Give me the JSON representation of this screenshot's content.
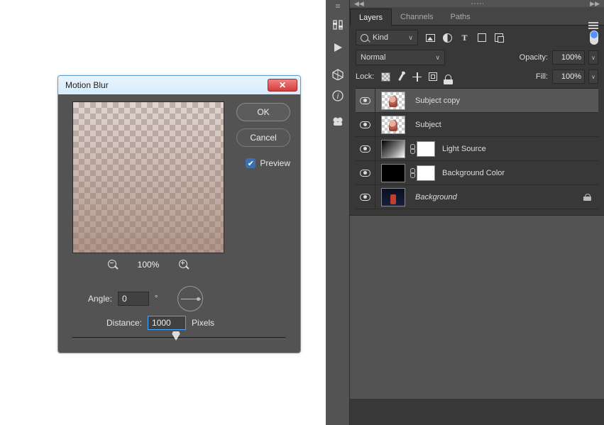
{
  "dialog": {
    "title": "Motion Blur",
    "ok": "OK",
    "cancel": "Cancel",
    "preview_label": "Preview",
    "preview_checked": true,
    "zoom": "100%",
    "angle_label": "Angle:",
    "angle_value": "0",
    "angle_unit": "°",
    "distance_label": "Distance:",
    "distance_value": "1000",
    "distance_unit": "Pixels"
  },
  "panel": {
    "tabs": [
      "Layers",
      "Channels",
      "Paths"
    ],
    "active_tab": 0,
    "filter": {
      "kind_label": "Kind"
    },
    "blend": {
      "mode": "Normal",
      "opacity_label": "Opacity:",
      "opacity_value": "100%"
    },
    "lock": {
      "label": "Lock:",
      "fill_label": "Fill:",
      "fill_value": "100%"
    },
    "layers": [
      {
        "name": "Subject copy",
        "visible": true,
        "type": "subject",
        "mask": false,
        "selected": true,
        "locked": false,
        "italic": false
      },
      {
        "name": "Subject",
        "visible": true,
        "type": "subject",
        "mask": false,
        "selected": false,
        "locked": false,
        "italic": false
      },
      {
        "name": "Light Source",
        "visible": true,
        "type": "gradient",
        "mask": true,
        "selected": false,
        "locked": false,
        "italic": false
      },
      {
        "name": "Background Color",
        "visible": true,
        "type": "black",
        "mask": true,
        "selected": false,
        "locked": false,
        "italic": false
      },
      {
        "name": "Background",
        "visible": true,
        "type": "bgimage",
        "mask": false,
        "selected": false,
        "locked": true,
        "italic": true
      }
    ]
  }
}
